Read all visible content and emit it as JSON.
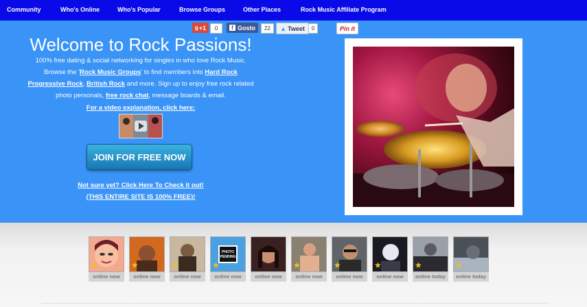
{
  "nav": {
    "items": [
      "Community",
      "Who's Online",
      "Who's Popular",
      "Browse Groups",
      "Other Places",
      "Rock Music Affiliate Program"
    ]
  },
  "share": {
    "gplus_label": "+1",
    "gplus_count": "0",
    "fb_label": "Gosto",
    "fb_count": "22",
    "tweet_label": "Tweet",
    "tweet_count": "0",
    "pin_label": "Pin it"
  },
  "hero": {
    "title": "Welcome to Rock Passions!",
    "l1": "100% free dating & social networking for singles in who love Rock Music.",
    "l2a": "Browse the '",
    "l2b": "Rock Music Groups",
    "l2c": "' to find members into ",
    "l2d": "Hard Rock",
    "l3a": "Progressive Rock",
    "l3b": ", ",
    "l3c": "British Rock",
    "l3d": " and more. Sign up to enjoy free rock related",
    "l4a": "photo personals, ",
    "l4b": "free rock chat",
    "l4c": ", message boards & email.",
    "video_link": "For a video explanation, click here:",
    "join_button": "JOIN FOR FREE NOW",
    "check_link": "Not sure yet? Click Here To Check it out!",
    "free_link": "(THIS ENTIRE SITE IS 100% FREE)!"
  },
  "members": [
    {
      "status": "online now",
      "photo": "cartoon-avatar"
    },
    {
      "status": "online now",
      "photo": "member-photo"
    },
    {
      "status": "online now",
      "photo": "member-photo"
    },
    {
      "status": "online now",
      "photo": "photo-pending",
      "pending_text": "PHOTO PENDING"
    },
    {
      "status": "online now",
      "photo": "member-photo"
    },
    {
      "status": "online now",
      "photo": "member-photo"
    },
    {
      "status": "online now",
      "photo": "member-photo"
    },
    {
      "status": "online now",
      "photo": "member-photo"
    },
    {
      "status": "online today",
      "photo": "member-photo"
    },
    {
      "status": "online today",
      "photo": "member-photo"
    }
  ],
  "colors": {
    "nav_bg": "#0a0ae8",
    "hero_bg": "#3a93f6",
    "join_button": "#1e88c4"
  }
}
